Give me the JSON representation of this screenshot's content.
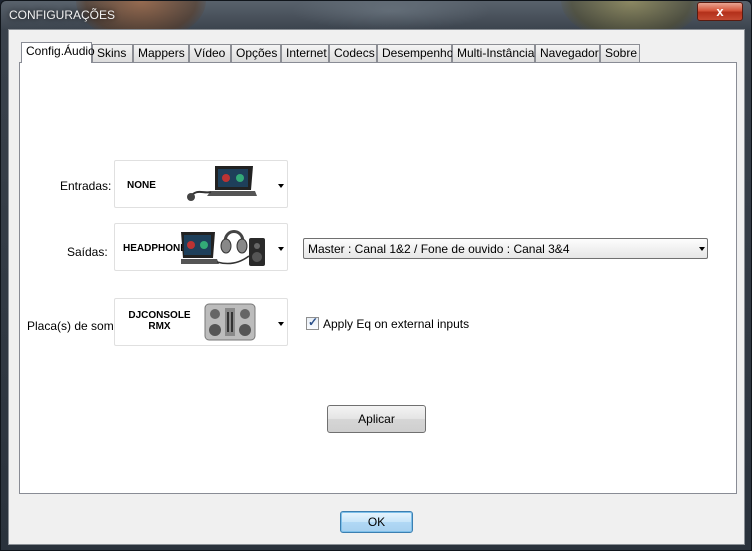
{
  "window": {
    "title": "CONFIGURAÇÕES",
    "close_label": "x"
  },
  "tabs": [
    {
      "label": "Config.Áudio",
      "active": true
    },
    {
      "label": "Skins"
    },
    {
      "label": "Mappers"
    },
    {
      "label": "Vídeo"
    },
    {
      "label": "Opções"
    },
    {
      "label": "Internet"
    },
    {
      "label": "Codecs"
    },
    {
      "label": "Desempenho"
    },
    {
      "label": "Multi-Instâncias"
    },
    {
      "label": "Navegador"
    },
    {
      "label": "Sobre"
    }
  ],
  "audio": {
    "inputs_label": "Entradas:",
    "inputs_device": "NONE",
    "outputs_label": "Saídas:",
    "outputs_device": "HEADPHONES",
    "outputs_routing": "Master : Canal 1&2 / Fone de ouvido : Canal 3&4",
    "soundcard_label": "Placa(s) de som:",
    "soundcard_device_line1": "DJCONSOLE",
    "soundcard_device_line2": "RMX",
    "apply_eq_label": "Apply Eq on external inputs",
    "apply_eq_checked": true,
    "apply_button": "Aplicar"
  },
  "footer": {
    "ok_button": "OK"
  }
}
